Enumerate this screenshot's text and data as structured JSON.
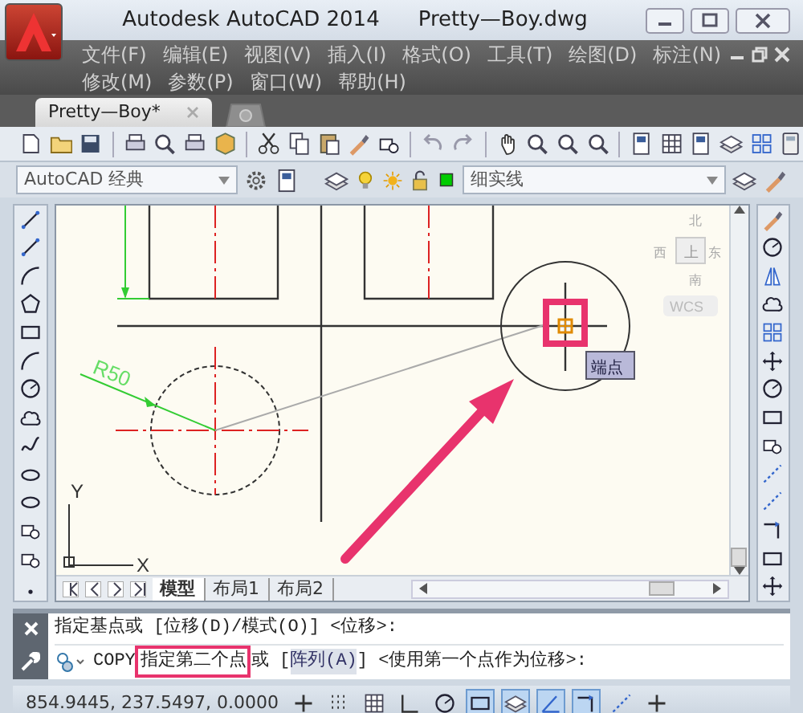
{
  "window": {
    "title": "Autodesk AutoCAD 2014",
    "document": "Pretty—Boy.dwg"
  },
  "menu_rows": [
    {
      "items": [
        "文件(F)",
        "编辑(E)",
        "视图(V)",
        "插入(I)",
        "格式(O)",
        "工具(T)",
        "绘图(D)",
        "标注(N)"
      ]
    },
    {
      "items": [
        "修改(M)",
        "参数(P)",
        "窗口(W)",
        "帮助(H)"
      ]
    }
  ],
  "document_tabs": [
    {
      "label": "Pretty—Boy*",
      "selected": true
    }
  ],
  "workspace": {
    "value": "AutoCAD 经典"
  },
  "layer": {
    "value": "细实线"
  },
  "drawing": {
    "dimension": "R50",
    "tooltip": "端点",
    "viewcube": {
      "north": "北",
      "west": "西",
      "top": "上",
      "east": "东",
      "south": "南",
      "wcs": "WCS"
    },
    "ucs": {
      "x": "X",
      "y": "Y"
    }
  },
  "layout_tabs": [
    {
      "label": "模型",
      "selected": true
    },
    {
      "label": "布局1",
      "selected": false
    },
    {
      "label": "布局2",
      "selected": false
    }
  ],
  "command_line": {
    "history": "指定基点或 [位移(D)/模式(O)] <位移>:",
    "command": "COPY",
    "prompt": "指定第二个点",
    "before_option": "或 [",
    "option": "阵列(A)",
    "after_option": "] <使用第一个点作为位移>:"
  },
  "status_bar": {
    "coordinates": "854.9445, 237.5497, 0.0000",
    "toggles": [
      {
        "kind": "infer",
        "on": false
      },
      {
        "kind": "snap",
        "on": false
      },
      {
        "kind": "grid",
        "on": false
      },
      {
        "kind": "ortho",
        "on": false
      },
      {
        "kind": "polar",
        "on": false
      },
      {
        "kind": "osnap",
        "on": true
      },
      {
        "kind": "osnap3d",
        "on": true
      },
      {
        "kind": "otrack",
        "on": true
      },
      {
        "kind": "ducs",
        "on": true
      },
      {
        "kind": "dyn",
        "on": false
      },
      {
        "kind": "lwt",
        "on": false
      }
    ]
  }
}
